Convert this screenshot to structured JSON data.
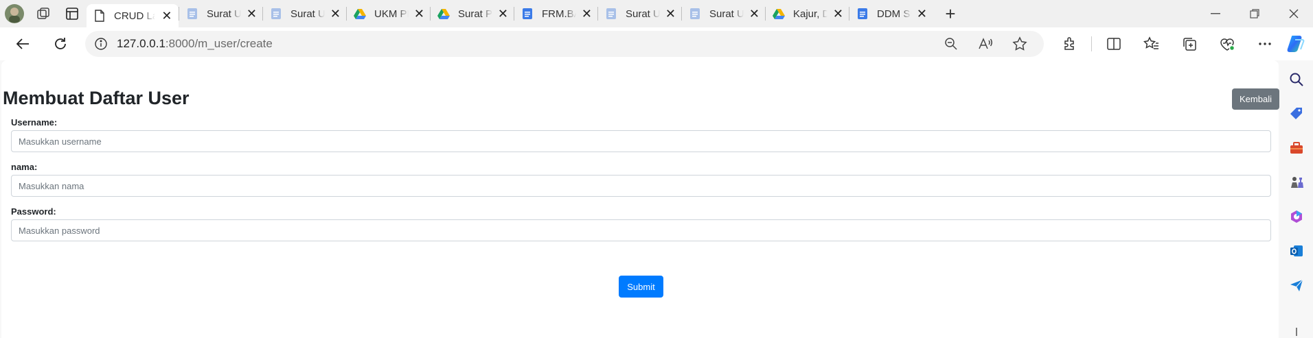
{
  "browser": {
    "tabs": [
      {
        "title": "CRUD Lar",
        "favicon": "page-icon",
        "active": true
      },
      {
        "title": "Surat Und",
        "favicon": "docs-icon"
      },
      {
        "title": "Surat Und",
        "favicon": "docs-icon"
      },
      {
        "title": "UKM PLFM",
        "favicon": "drive-icon"
      },
      {
        "title": "Surat Pem",
        "favicon": "drive-icon"
      },
      {
        "title": "FRM.BAA.",
        "favicon": "gdocs-icon"
      },
      {
        "title": "Surat Und",
        "favicon": "docs-icon"
      },
      {
        "title": "Surat Und",
        "favicon": "docs-icon"
      },
      {
        "title": "Kajur, DPA",
        "favicon": "drive-icon"
      },
      {
        "title": "DDM SUR",
        "favicon": "gdocs-icon"
      }
    ],
    "close_glyph": "✕",
    "new_tab_glyph": "+",
    "address": {
      "host": "127.0.0.1",
      "path": ":8000/m_user/create"
    }
  },
  "page": {
    "title": "Membuat Daftar User",
    "back_label": "Kembali",
    "fields": [
      {
        "label": "Username:",
        "placeholder": "Masukkan username"
      },
      {
        "label": "nama:",
        "placeholder": "Masukkan nama"
      },
      {
        "label": "Password:",
        "placeholder": "Masukkan password"
      }
    ],
    "submit_label": "Submit"
  },
  "colors": {
    "back_button": "#6c757d",
    "submit_button": "#007bff"
  }
}
